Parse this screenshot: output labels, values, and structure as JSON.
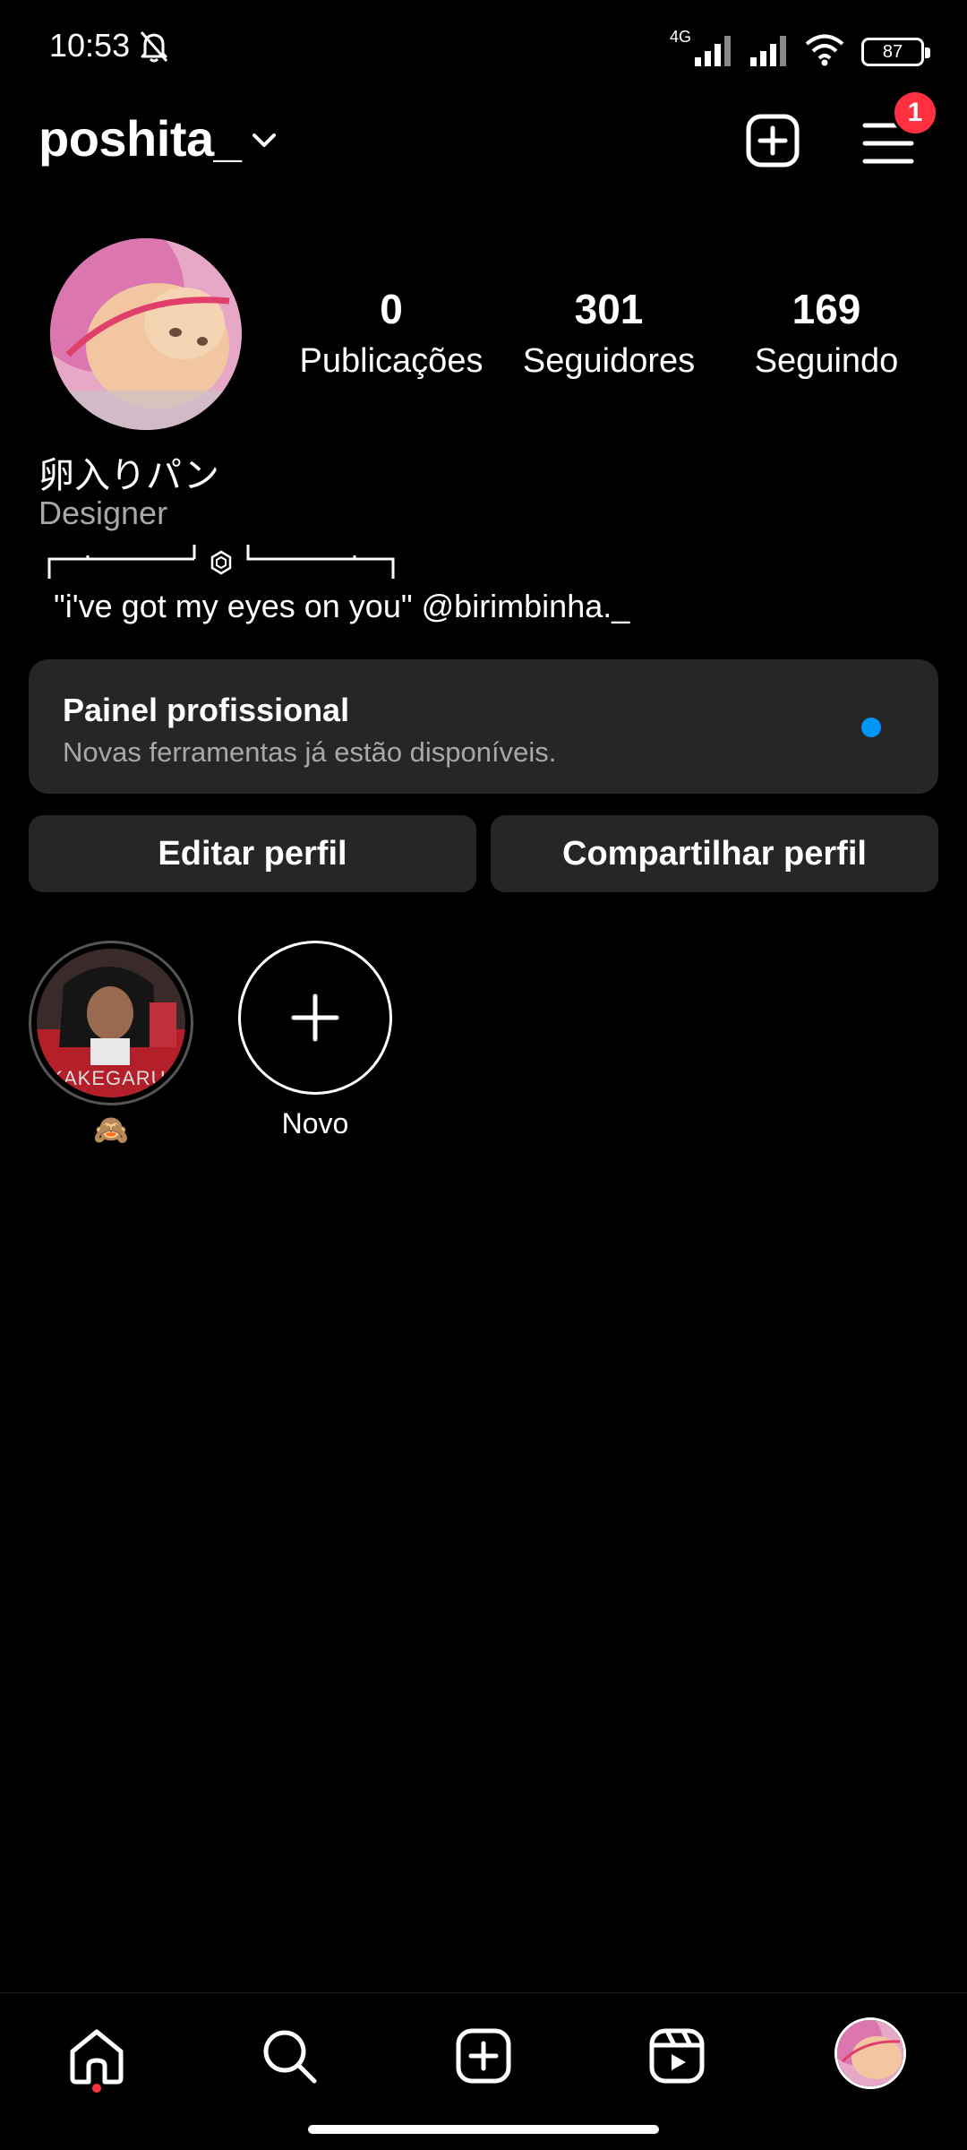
{
  "status_bar": {
    "time": "10:53",
    "network": "4G",
    "battery": "87"
  },
  "header": {
    "username": "poshita_",
    "notification_count": "1",
    "icons": [
      "chevron-down-icon",
      "new-post-icon",
      "menu-icon"
    ]
  },
  "profile": {
    "stats": [
      {
        "value": "0",
        "label": "Publicações"
      },
      {
        "value": "301",
        "label": "Seguidores"
      },
      {
        "value": "169",
        "label": "Seguindo"
      }
    ],
    "display_name": "卵入りパン",
    "category": "Designer",
    "bio": "\"i've got my eyes on you\" @birimbinha._"
  },
  "pro_panel": {
    "title": "Painel profissional",
    "subtitle": "Novas ferramentas já estão disponíveis.",
    "dot_color": "#0095f6"
  },
  "buttons": {
    "edit": "Editar perfil",
    "share": "Compartilhar perfil"
  },
  "highlights": [
    {
      "label": "🙈",
      "cover_text": "KAKEGARUI"
    },
    {
      "label": "Novo"
    }
  ],
  "bottom_nav": {
    "items": [
      "home-icon",
      "search-icon",
      "create-icon",
      "reels-icon",
      "profile-avatar"
    ],
    "active": "home-icon"
  },
  "colors": {
    "background": "#000000",
    "surface": "#262626",
    "secondary_text": "#a8a8a8",
    "badge": "#ff3040",
    "accent": "#0095f6"
  }
}
